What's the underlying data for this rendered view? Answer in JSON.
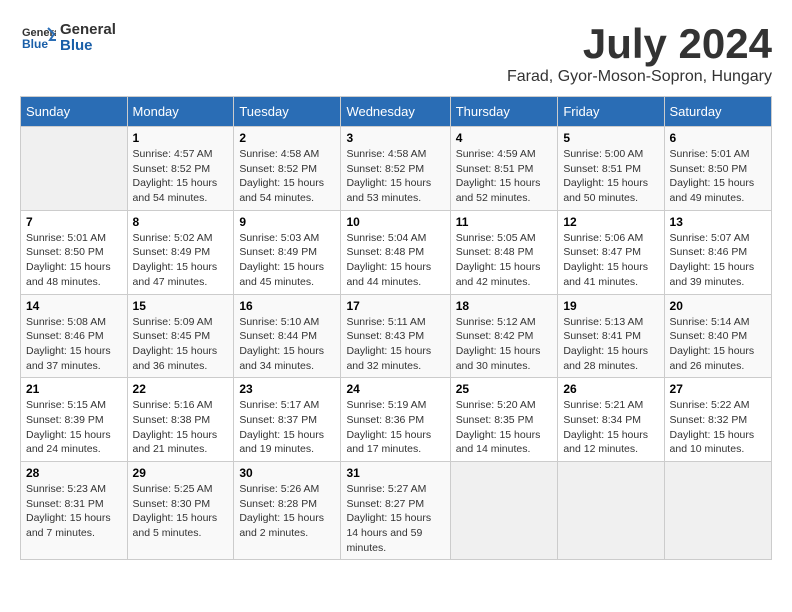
{
  "header": {
    "logo_text_general": "General",
    "logo_text_blue": "Blue",
    "month_title": "July 2024",
    "location": "Farad, Gyor-Moson-Sopron, Hungary"
  },
  "days_of_week": [
    "Sunday",
    "Monday",
    "Tuesday",
    "Wednesday",
    "Thursday",
    "Friday",
    "Saturday"
  ],
  "weeks": [
    [
      {
        "day": "",
        "empty": true
      },
      {
        "day": "1",
        "sunrise": "4:57 AM",
        "sunset": "8:52 PM",
        "daylight": "15 hours and 54 minutes."
      },
      {
        "day": "2",
        "sunrise": "4:58 AM",
        "sunset": "8:52 PM",
        "daylight": "15 hours and 54 minutes."
      },
      {
        "day": "3",
        "sunrise": "4:58 AM",
        "sunset": "8:52 PM",
        "daylight": "15 hours and 53 minutes."
      },
      {
        "day": "4",
        "sunrise": "4:59 AM",
        "sunset": "8:51 PM",
        "daylight": "15 hours and 52 minutes."
      },
      {
        "day": "5",
        "sunrise": "5:00 AM",
        "sunset": "8:51 PM",
        "daylight": "15 hours and 50 minutes."
      },
      {
        "day": "6",
        "sunrise": "5:01 AM",
        "sunset": "8:50 PM",
        "daylight": "15 hours and 49 minutes."
      }
    ],
    [
      {
        "day": "7",
        "sunrise": "5:01 AM",
        "sunset": "8:50 PM",
        "daylight": "15 hours and 48 minutes."
      },
      {
        "day": "8",
        "sunrise": "5:02 AM",
        "sunset": "8:49 PM",
        "daylight": "15 hours and 47 minutes."
      },
      {
        "day": "9",
        "sunrise": "5:03 AM",
        "sunset": "8:49 PM",
        "daylight": "15 hours and 45 minutes."
      },
      {
        "day": "10",
        "sunrise": "5:04 AM",
        "sunset": "8:48 PM",
        "daylight": "15 hours and 44 minutes."
      },
      {
        "day": "11",
        "sunrise": "5:05 AM",
        "sunset": "8:48 PM",
        "daylight": "15 hours and 42 minutes."
      },
      {
        "day": "12",
        "sunrise": "5:06 AM",
        "sunset": "8:47 PM",
        "daylight": "15 hours and 41 minutes."
      },
      {
        "day": "13",
        "sunrise": "5:07 AM",
        "sunset": "8:46 PM",
        "daylight": "15 hours and 39 minutes."
      }
    ],
    [
      {
        "day": "14",
        "sunrise": "5:08 AM",
        "sunset": "8:46 PM",
        "daylight": "15 hours and 37 minutes."
      },
      {
        "day": "15",
        "sunrise": "5:09 AM",
        "sunset": "8:45 PM",
        "daylight": "15 hours and 36 minutes."
      },
      {
        "day": "16",
        "sunrise": "5:10 AM",
        "sunset": "8:44 PM",
        "daylight": "15 hours and 34 minutes."
      },
      {
        "day": "17",
        "sunrise": "5:11 AM",
        "sunset": "8:43 PM",
        "daylight": "15 hours and 32 minutes."
      },
      {
        "day": "18",
        "sunrise": "5:12 AM",
        "sunset": "8:42 PM",
        "daylight": "15 hours and 30 minutes."
      },
      {
        "day": "19",
        "sunrise": "5:13 AM",
        "sunset": "8:41 PM",
        "daylight": "15 hours and 28 minutes."
      },
      {
        "day": "20",
        "sunrise": "5:14 AM",
        "sunset": "8:40 PM",
        "daylight": "15 hours and 26 minutes."
      }
    ],
    [
      {
        "day": "21",
        "sunrise": "5:15 AM",
        "sunset": "8:39 PM",
        "daylight": "15 hours and 24 minutes."
      },
      {
        "day": "22",
        "sunrise": "5:16 AM",
        "sunset": "8:38 PM",
        "daylight": "15 hours and 21 minutes."
      },
      {
        "day": "23",
        "sunrise": "5:17 AM",
        "sunset": "8:37 PM",
        "daylight": "15 hours and 19 minutes."
      },
      {
        "day": "24",
        "sunrise": "5:19 AM",
        "sunset": "8:36 PM",
        "daylight": "15 hours and 17 minutes."
      },
      {
        "day": "25",
        "sunrise": "5:20 AM",
        "sunset": "8:35 PM",
        "daylight": "15 hours and 14 minutes."
      },
      {
        "day": "26",
        "sunrise": "5:21 AM",
        "sunset": "8:34 PM",
        "daylight": "15 hours and 12 minutes."
      },
      {
        "day": "27",
        "sunrise": "5:22 AM",
        "sunset": "8:32 PM",
        "daylight": "15 hours and 10 minutes."
      }
    ],
    [
      {
        "day": "28",
        "sunrise": "5:23 AM",
        "sunset": "8:31 PM",
        "daylight": "15 hours and 7 minutes."
      },
      {
        "day": "29",
        "sunrise": "5:25 AM",
        "sunset": "8:30 PM",
        "daylight": "15 hours and 5 minutes."
      },
      {
        "day": "30",
        "sunrise": "5:26 AM",
        "sunset": "8:28 PM",
        "daylight": "15 hours and 2 minutes."
      },
      {
        "day": "31",
        "sunrise": "5:27 AM",
        "sunset": "8:27 PM",
        "daylight": "14 hours and 59 minutes."
      },
      {
        "day": "",
        "empty": true
      },
      {
        "day": "",
        "empty": true
      },
      {
        "day": "",
        "empty": true
      }
    ]
  ]
}
